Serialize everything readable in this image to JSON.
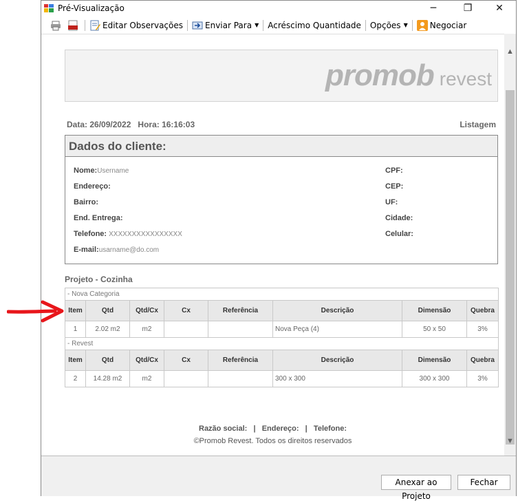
{
  "window": {
    "title": "Pré-Visualização"
  },
  "toolbar": {
    "edit": "Editar Observações",
    "send": "Enviar Para",
    "qty": "Acréscimo Quantidade",
    "options": "Opções",
    "negotiate": "Negociar"
  },
  "report": {
    "logo_brand": "promob",
    "logo_sub": "revest",
    "date": "Data: 26/09/2022",
    "time": "Hora: 16:16:03",
    "listing": "Listagem",
    "client_title": "Dados do cliente:",
    "name_label": "Nome:",
    "name_value": "Username",
    "address_label": "Endereço:",
    "district_label": "Bairro:",
    "delivery_label": "End. Entrega:",
    "phone_label": "Telefone:",
    "phone_value": "XXXXXXXXXXXXXXXX",
    "email_label": "E-mail:",
    "email_value": "usarname@do.com",
    "cpf_label": "CPF:",
    "cep_label": "CEP:",
    "uf_label": "UF:",
    "city_label": "Cidade:",
    "cell_label": "Celular:",
    "project": "Projeto - Cozinha",
    "headers": [
      "Item",
      "Qtd",
      "Qtd/Cx",
      "Cx",
      "Referência",
      "Descrição",
      "Dimensão",
      "Quebra"
    ],
    "groups": [
      {
        "category": "- Nova Categoria",
        "row": [
          "1",
          "2.02 m2",
          "m2",
          "",
          "",
          "Nova Peça (4)",
          "50 x 50",
          "3%"
        ]
      },
      {
        "category": "- Revest",
        "row": [
          "2",
          "14.28 m2",
          "m2",
          "",
          "",
          "300 x 300",
          "300 x 300",
          "3%"
        ]
      }
    ],
    "footer_line1": "Razão social:   |   Endereço:   |   Telefone:",
    "footer_line2": "©Promob Revest. Todos os direitos reservados"
  },
  "buttons": {
    "attach": "Anexar ao Projeto",
    "close": "Fechar"
  },
  "colors": {
    "arrow": "#e8161b"
  }
}
